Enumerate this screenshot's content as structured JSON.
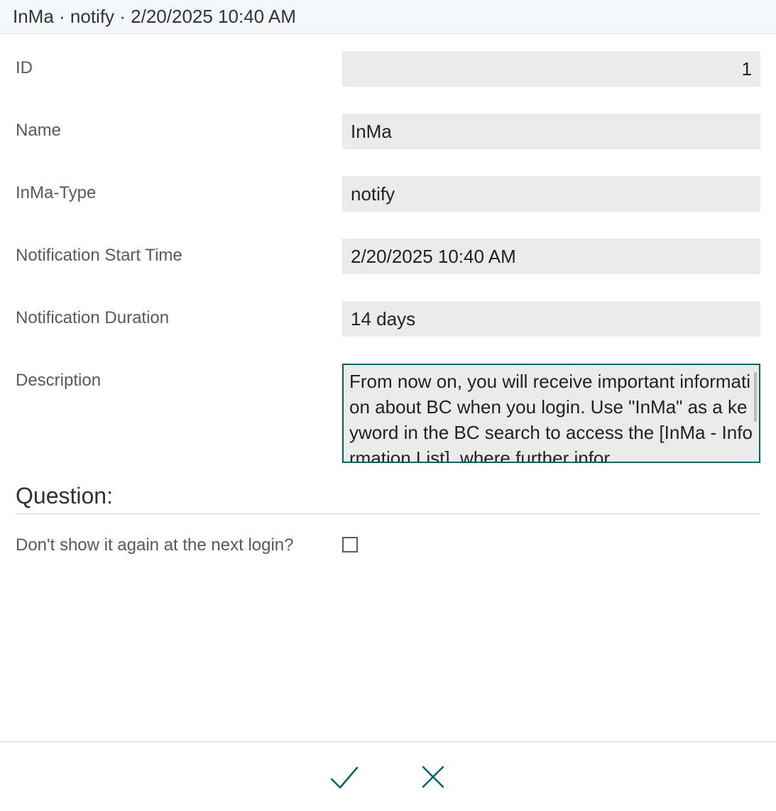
{
  "titlebar": {
    "text": "InMa · notify · 2/20/2025 10:40 AM"
  },
  "fields": {
    "id": {
      "label": "ID",
      "value": "1"
    },
    "name": {
      "label": "Name",
      "value": "InMa"
    },
    "type": {
      "label": "InMa-Type",
      "value": "notify"
    },
    "start": {
      "label": "Notification Start Time",
      "value": "2/20/2025 10:40 AM"
    },
    "dur": {
      "label": "Notification Duration",
      "value": "14 days"
    },
    "desc": {
      "label": "Description",
      "value": "From now on, you will receive important information about BC when you login. Use \"InMa\" as a keyword in the BC search to access the [InMa - Information List], where further infor"
    }
  },
  "question": {
    "title": "Question:",
    "dont_show_label": "Don't show it again at the next login?",
    "dont_show_checked": false
  },
  "footer": {
    "ok_label": "OK",
    "cancel_label": "Cancel",
    "accent": "#006666"
  }
}
